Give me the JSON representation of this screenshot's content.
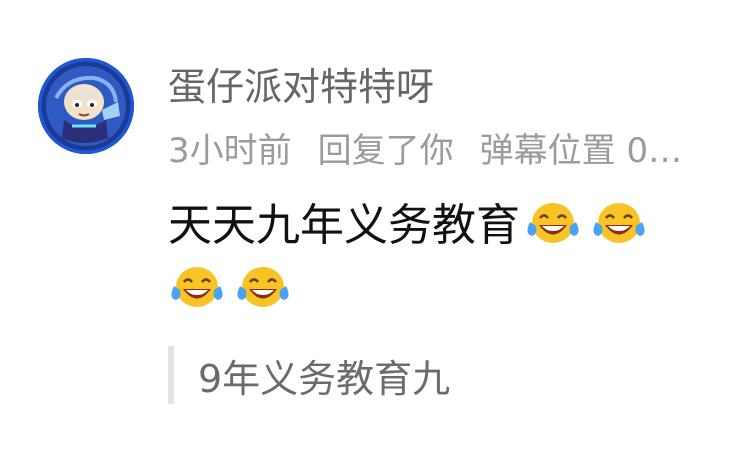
{
  "comment": {
    "avatar_icon": "user-avatar-icon",
    "username": "蛋仔派对特特呀",
    "time": "3小时前",
    "reply_action": "回复了你",
    "danmu_label": "弹幕位置 0…",
    "body_text": "天天九年义务教育",
    "emoji_name": "tears-of-joy-emoji",
    "emoji_count": 4,
    "quoted_text": "9年义务教育九"
  },
  "colors": {
    "username": "#666666",
    "meta": "#9b9b9b",
    "body": "#111111",
    "quote_bar": "#e3e3e3",
    "quote_text": "#6b6b6b",
    "avatar_ring": "#1e57d6"
  }
}
